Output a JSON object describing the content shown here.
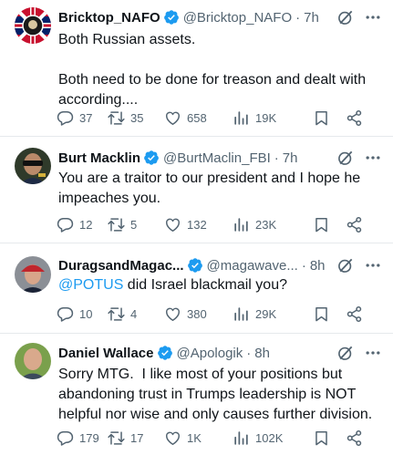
{
  "tweets": [
    {
      "name": "Bricktop_NAFO",
      "handle": "@Bricktop_NAFO",
      "time": "7h",
      "text": "Both Russian assets.\n\nBoth need to be done for treason and dealt with according....",
      "replies": "37",
      "retweets": "35",
      "likes": "658",
      "views": "19K",
      "avatar_icon": "nafo-emblem-avatar"
    },
    {
      "name": "Burt Macklin",
      "handle": "@BurtMaclin_FBI",
      "time": "7h",
      "text": "You are a traitor to our president and I hope he impeaches you.",
      "replies": "12",
      "retweets": "5",
      "likes": "132",
      "views": "23K",
      "avatar_icon": "sunglasses-man-avatar"
    },
    {
      "name": "DuragsandMagac...",
      "handle": "@magawave...",
      "time": "8h",
      "mention": "@POTUS",
      "text": " did Israel blackmail you?",
      "replies": "10",
      "retweets": "4",
      "likes": "380",
      "views": "29K",
      "avatar_icon": "red-cap-avatar"
    },
    {
      "name": "Daniel Wallace",
      "handle": "@Apologik",
      "time": "8h",
      "text": "Sorry MTG.  I like most of your positions but abandoning trust in Trumps leadership is NOT helpful nor wise and only causes further division.",
      "replies": "179",
      "retweets": "17",
      "likes": "1K",
      "views": "102K",
      "avatar_icon": "bald-man-avatar"
    }
  ],
  "colors": {
    "text": "#0f1419",
    "muted": "#536471",
    "accent": "#1d9bf0",
    "divider": "#e6e9ec"
  },
  "icons": [
    "verified-badge-icon",
    "grok-icon",
    "more-icon",
    "reply-icon",
    "retweet-icon",
    "like-icon",
    "views-icon",
    "bookmark-icon",
    "share-icon"
  ]
}
